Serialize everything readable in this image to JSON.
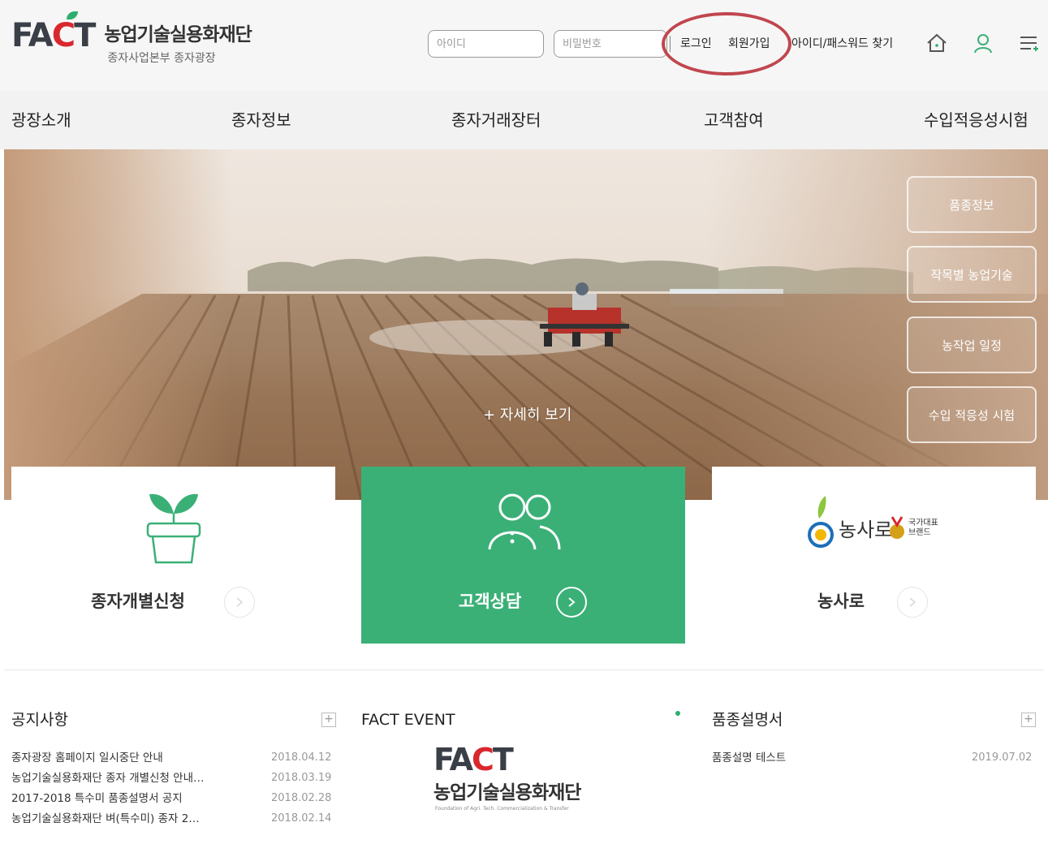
{
  "header": {
    "logo_mark_left": "FA",
    "logo_mark_c": "C",
    "logo_mark_right": "T",
    "logo_title": "농업기술실용화재단",
    "logo_subtitle": "종자사업본부 종자광장",
    "id_placeholder": "아이디",
    "pw_placeholder": "비밀번호",
    "login_label": "로그인",
    "signup_label": "회원가입",
    "find_label": "아이디/패스워드 찾기"
  },
  "nav": {
    "items": [
      "광장소개",
      "종자정보",
      "종자거래장터",
      "고객참여",
      "수입적응성시험"
    ]
  },
  "hero": {
    "detail_label": "+ 자세히 보기",
    "side_buttons": [
      "품종정보",
      "작목별 농업기술",
      "농작업 일정",
      "수입 적응성 시험"
    ]
  },
  "cards": {
    "seed_label": "종자개별신청",
    "consult_label": "고객상담",
    "nongsaro_label": "농사로",
    "brand_text_1": "국가대표",
    "brand_text_2": "브랜드"
  },
  "notice": {
    "title": "공지사항",
    "items": [
      {
        "title": "종자광장 홈페이지 일시중단 안내",
        "date": "2018.04.12"
      },
      {
        "title": "농업기술실용화재단 종자 개별신청 안내…",
        "date": "2018.03.19"
      },
      {
        "title": "2017-2018 특수미 품종설명서 공지",
        "date": "2018.02.28"
      },
      {
        "title": "농업기술실용화재단 벼(특수미) 종자 2…",
        "date": "2018.02.14"
      }
    ]
  },
  "event": {
    "title": "FACT EVENT",
    "logo_mark_left": "FA",
    "logo_mark_c": "C",
    "logo_mark_right": "T",
    "logo_text": "농업기술실용화재단",
    "logo_en": "Foundation of Agri. Tech. Commercialization & Transfer"
  },
  "manual": {
    "title": "품종설명서",
    "items": [
      {
        "title": "품종설명 테스트",
        "date": "2019.07.02"
      }
    ]
  },
  "colors": {
    "brand_green": "#3ab077",
    "brand_red": "#d9272e",
    "highlight": "#c0464e"
  }
}
